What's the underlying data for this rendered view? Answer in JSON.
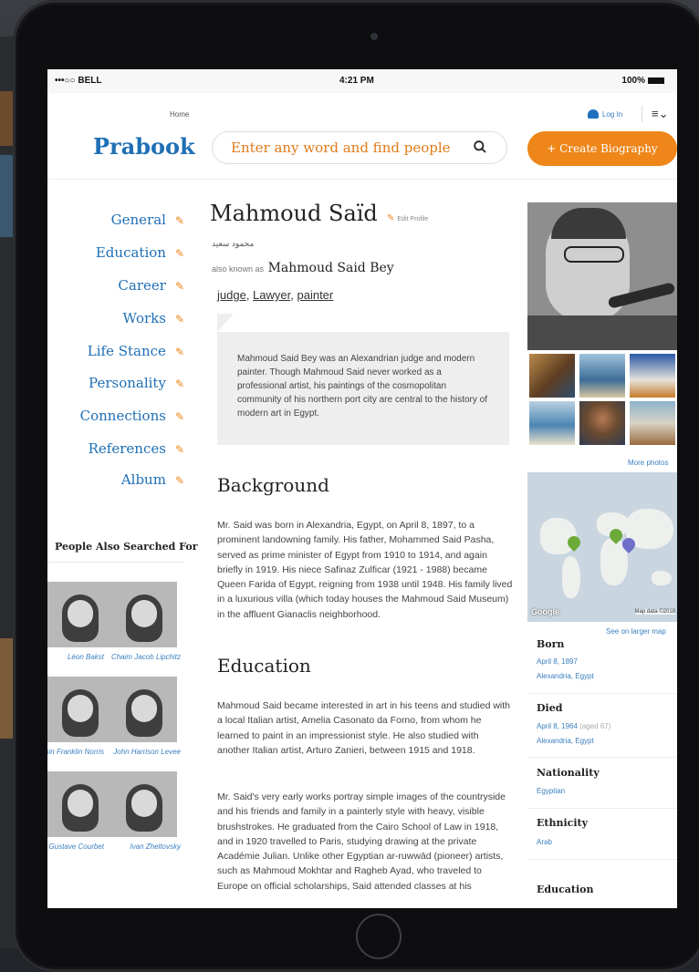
{
  "status_bar": {
    "carrier": "•••○○ BELL",
    "time": "4:21 PM",
    "battery": "100%"
  },
  "header": {
    "home_link": "Home",
    "login": "Log In",
    "logo": "Prabook",
    "search_placeholder": "Enter any word and find people",
    "create_button": "+ Create Biography"
  },
  "nav": {
    "items": [
      {
        "label": "General"
      },
      {
        "label": "Education"
      },
      {
        "label": "Career"
      },
      {
        "label": "Works"
      },
      {
        "label": "Life Stance"
      },
      {
        "label": "Personality"
      },
      {
        "label": "Connections"
      },
      {
        "label": "References"
      },
      {
        "label": "Album"
      }
    ]
  },
  "people_also_searched": {
    "title": "People Also Searched For",
    "people": [
      {
        "name": "Léon Bakst"
      },
      {
        "name": "Chaim Jacob Lipchitz"
      },
      {
        "name": "Benjamin Franklin Norris"
      },
      {
        "name": "John Harrison Levee"
      },
      {
        "name": "Gustave Courbet"
      },
      {
        "name": "Ivan Zheltovsky"
      }
    ]
  },
  "profile": {
    "name": "Mahmoud Saïd",
    "edit_label": "Edit Profile",
    "arabic_name": "محمود سعيد",
    "aka_label": "also known as",
    "aka_name": "Mahmoud Said Bey",
    "professions": [
      "judge",
      "Lawyer",
      "painter"
    ],
    "summary": "Mahmoud Said Bey was an Alexandrian judge and modern painter. Though Mahmoud Said never worked as a professional artist, his paintings of the cosmopolitan community of his northern port city are central to the history of modern art in Egypt."
  },
  "sections": {
    "background_title": "Background",
    "background_text": "Mr. Said was born in Alexandria, Egypt, on April 8, 1897, to a prominent landowning family. His father, Mohammed Said Pasha, served as prime minister of Egypt from 1910 to 1914, and again briefly in 1919. His niece Safinaz Zulficar (1921 - 1988) became Queen Farida of Egypt, reigning from 1938 until 1948. His family lived in a luxurious villa (which today houses the Mahmoud Said Museum) in the affluent Gianaclis neighborhood.",
    "education_title": "Education",
    "education_text_1": "Mahmoud Said became interested in art in his teens and studied with a local Italian artist, Amelia Casonato da Forno, from whom he learned to paint in an impressionist style. He also studied with another Italian artist, Arturo Zanieri, between 1915 and 1918.",
    "education_text_2": "Mr. Said's very early works portray simple images of the countryside and his friends and family in a painterly style with heavy, visible brushstrokes. He graduated from the Cairo School of Law in 1918, and in 1920 travelled to Paris, studying drawing at the private Académie Julian. Unlike other Egyptian ar-ruwwād (pioneer) artists, such as Mahmoud Mokhtar and Ragheb Ayad, who traveled to Europe on official scholarships, Said attended classes at his"
  },
  "sidebar": {
    "more_photos": "More photos",
    "map_brand": "Google",
    "map_data": "Map data ©2018",
    "see_larger": "See on larger map",
    "born_label": "Born",
    "born_date": "April 8, 1897",
    "born_place": "Alexandria, Egypt",
    "died_label": "Died",
    "died_date": "April 8, 1964",
    "died_age": "(aged 67)",
    "died_place": "Alexandria, Egypt",
    "nationality_label": "Nationality",
    "nationality_value": "Egyptian",
    "ethnicity_label": "Ethnicity",
    "ethnicity_value": "Arab",
    "education_label": "Education"
  }
}
